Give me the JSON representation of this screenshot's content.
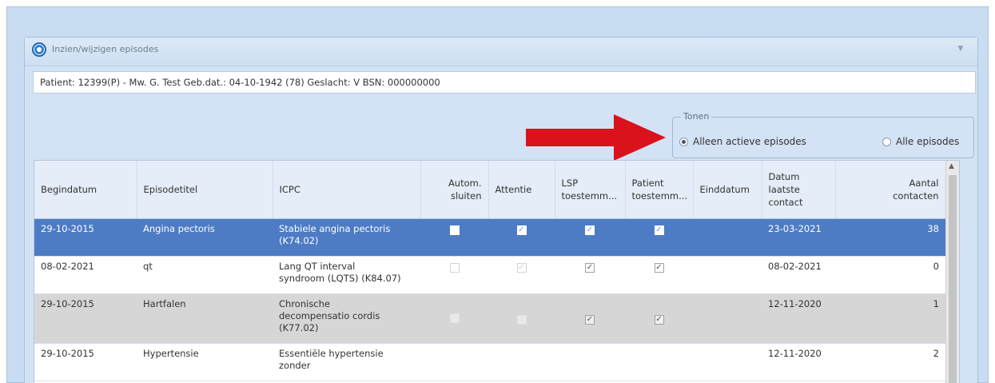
{
  "window": {
    "title": "Inzien/wijzigen episodes",
    "collapse_glyph": "▼"
  },
  "patient_info": "Patient: 12399(P) - Mw. G. Test Geb.dat.: 04-10-1942 (78) Geslacht: V BSN: 000000000",
  "tonen": {
    "legend": "Tonen",
    "options": [
      {
        "label": "Alleen actieve episodes",
        "selected": true
      },
      {
        "label": "Alle episodes",
        "selected": false
      }
    ]
  },
  "annotation": {
    "color": "#d9121b",
    "icon": "red-arrow-right"
  },
  "table": {
    "columns": {
      "begindatum": "Begindatum",
      "episodetitel": "Episodetitel",
      "icpc": "ICPC",
      "autom_1": "Autom.",
      "autom_2": "sluiten",
      "attentie": "Attentie",
      "lsp_1": "LSP",
      "lsp_2": "toestemm...",
      "patient_1": "Patient",
      "patient_2": "toestemm...",
      "einddatum": "Einddatum",
      "datum_1": "Datum",
      "datum_2": "laatste",
      "datum_3": "contact",
      "aantal_1": "Aantal",
      "aantal_2": "contacten"
    },
    "rows": [
      {
        "begindatum": "29-10-2015",
        "episodetitel": "Angina pectoris",
        "icpc_1": "Stabiele angina pectoris",
        "icpc_2": "(K74.02)",
        "icpc_3": "",
        "autom": "",
        "attentie": "✓",
        "lsp": "✓",
        "patient": "✓",
        "einddatum": "",
        "datum": "23-03-2021",
        "aantal": "38"
      },
      {
        "begindatum": "08-02-2021",
        "episodetitel": "qt",
        "icpc_1": "Lang QT interval",
        "icpc_2": "syndroom (LQTS) (K84.07)",
        "icpc_3": "",
        "autom": "",
        "attentie": "✓",
        "lsp": "✓",
        "patient": "✓",
        "einddatum": "",
        "datum": "08-02-2021",
        "aantal": "0"
      },
      {
        "begindatum": "29-10-2015",
        "episodetitel": "Hartfalen",
        "icpc_1": "Chronische",
        "icpc_2": "decompensatio cordis",
        "icpc_3": "(K77.02)",
        "autom": "",
        "attentie": "✓",
        "lsp": "✓",
        "patient": "✓",
        "einddatum": "",
        "datum": "12-11-2020",
        "aantal": "1"
      },
      {
        "begindatum": "29-10-2015",
        "episodetitel": "Hypertensie",
        "icpc_1": "Essentiële hypertensie",
        "icpc_2": "zonder",
        "icpc_3": "",
        "autom": "",
        "attentie": "",
        "lsp": "",
        "patient": "",
        "einddatum": "",
        "datum": "12-11-2020",
        "aantal": "2"
      }
    ]
  },
  "scrollbar": {
    "up_glyph": "▲"
  }
}
